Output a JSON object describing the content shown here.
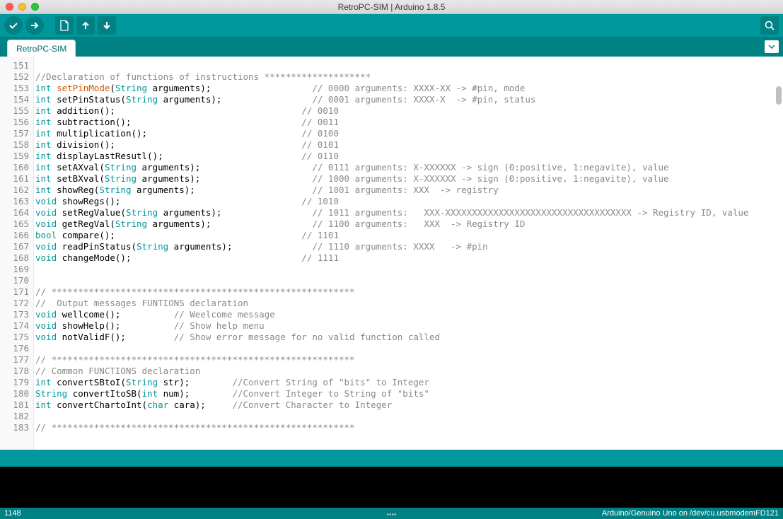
{
  "window": {
    "title": "RetroPC-SIM | Arduino 1.8.5"
  },
  "tab": {
    "name": "RetroPC-SIM"
  },
  "footer": {
    "left": "1148",
    "right": "Arduino/Genuino Uno on /dev/cu.usbmodemFD121"
  },
  "code": {
    "first_line_no": 151,
    "lines": [
      {
        "n": 151,
        "tokens": []
      },
      {
        "n": 152,
        "tokens": [
          {
            "t": "//Declaration of functions of instructions ********************",
            "c": "cm"
          }
        ]
      },
      {
        "n": 153,
        "tokens": [
          {
            "t": "int ",
            "c": "kw"
          },
          {
            "t": "setPinMode",
            "c": "fn"
          },
          {
            "t": "("
          },
          {
            "t": "String",
            "c": "kw"
          },
          {
            "t": " arguments);                   "
          },
          {
            "t": "// 0000 arguments: XXXX-XX -> #pin, mode",
            "c": "cm"
          }
        ]
      },
      {
        "n": 154,
        "tokens": [
          {
            "t": "int ",
            "c": "kw"
          },
          {
            "t": "setPinStatus("
          },
          {
            "t": "String",
            "c": "kw"
          },
          {
            "t": " arguments);                 "
          },
          {
            "t": "// 0001 arguments: XXXX-X  -> #pin, status",
            "c": "cm"
          }
        ]
      },
      {
        "n": 155,
        "tokens": [
          {
            "t": "int ",
            "c": "kw"
          },
          {
            "t": "addition();                                   "
          },
          {
            "t": "// 0010",
            "c": "cm"
          }
        ]
      },
      {
        "n": 156,
        "tokens": [
          {
            "t": "int ",
            "c": "kw"
          },
          {
            "t": "subtraction();                                "
          },
          {
            "t": "// 0011",
            "c": "cm"
          }
        ]
      },
      {
        "n": 157,
        "tokens": [
          {
            "t": "int ",
            "c": "kw"
          },
          {
            "t": "multiplication();                             "
          },
          {
            "t": "// 0100",
            "c": "cm"
          }
        ]
      },
      {
        "n": 158,
        "tokens": [
          {
            "t": "int ",
            "c": "kw"
          },
          {
            "t": "division();                                   "
          },
          {
            "t": "// 0101",
            "c": "cm"
          }
        ]
      },
      {
        "n": 159,
        "tokens": [
          {
            "t": "int ",
            "c": "kw"
          },
          {
            "t": "displayLastResutl();                          "
          },
          {
            "t": "// 0110",
            "c": "cm"
          }
        ]
      },
      {
        "n": 160,
        "tokens": [
          {
            "t": "int ",
            "c": "kw"
          },
          {
            "t": "setAXval("
          },
          {
            "t": "String",
            "c": "kw"
          },
          {
            "t": " arguments);                     "
          },
          {
            "t": "// 0111 arguments: X-XXXXXX -> sign (0:positive, 1:negavite), value",
            "c": "cm"
          }
        ]
      },
      {
        "n": 161,
        "tokens": [
          {
            "t": "int ",
            "c": "kw"
          },
          {
            "t": "setBXval("
          },
          {
            "t": "String",
            "c": "kw"
          },
          {
            "t": " arguments);                     "
          },
          {
            "t": "// 1000 arguments: X-XXXXXX -> sign (0:positive, 1:negavite), value",
            "c": "cm"
          }
        ]
      },
      {
        "n": 162,
        "tokens": [
          {
            "t": "int ",
            "c": "kw"
          },
          {
            "t": "showReg("
          },
          {
            "t": "String",
            "c": "kw"
          },
          {
            "t": " arguments);                      "
          },
          {
            "t": "// 1001 arguments: XXX  -> registry",
            "c": "cm"
          }
        ]
      },
      {
        "n": 163,
        "tokens": [
          {
            "t": "void ",
            "c": "kw"
          },
          {
            "t": "showRegs();                                  "
          },
          {
            "t": "// 1010",
            "c": "cm"
          }
        ]
      },
      {
        "n": 164,
        "tokens": [
          {
            "t": "void ",
            "c": "kw"
          },
          {
            "t": "setRegValue("
          },
          {
            "t": "String",
            "c": "kw"
          },
          {
            "t": " arguments);                 "
          },
          {
            "t": "// 1011 arguments:   XXX-XXXXXXXXXXXXXXXXXXXXXXXXXXXXXXXXXXX -> Registry ID, value",
            "c": "cm"
          }
        ]
      },
      {
        "n": 165,
        "tokens": [
          {
            "t": "void ",
            "c": "kw"
          },
          {
            "t": "getRegVal("
          },
          {
            "t": "String",
            "c": "kw"
          },
          {
            "t": " arguments);                   "
          },
          {
            "t": "// 1100 arguments:   XXX  -> Registry ID",
            "c": "cm"
          }
        ]
      },
      {
        "n": 166,
        "tokens": [
          {
            "t": "bool ",
            "c": "kw"
          },
          {
            "t": "compare();                                   "
          },
          {
            "t": "// 1101",
            "c": "cm"
          }
        ]
      },
      {
        "n": 167,
        "tokens": [
          {
            "t": "void ",
            "c": "kw"
          },
          {
            "t": "readPinStatus("
          },
          {
            "t": "String",
            "c": "kw"
          },
          {
            "t": " arguments);               "
          },
          {
            "t": "// 1110 arguments: XXXX   -> #pin",
            "c": "cm"
          }
        ]
      },
      {
        "n": 168,
        "tokens": [
          {
            "t": "void ",
            "c": "kw"
          },
          {
            "t": "changeMode();                                "
          },
          {
            "t": "// 1111",
            "c": "cm"
          }
        ]
      },
      {
        "n": 169,
        "tokens": []
      },
      {
        "n": 170,
        "tokens": []
      },
      {
        "n": 171,
        "tokens": [
          {
            "t": "// *********************************************************",
            "c": "cm"
          }
        ]
      },
      {
        "n": 172,
        "tokens": [
          {
            "t": "//  Output messages FUNTIONS declaration",
            "c": "cm"
          }
        ]
      },
      {
        "n": 173,
        "tokens": [
          {
            "t": "void ",
            "c": "kw"
          },
          {
            "t": "wellcome();          "
          },
          {
            "t": "// Weelcome message",
            "c": "cm"
          }
        ]
      },
      {
        "n": 174,
        "tokens": [
          {
            "t": "void ",
            "c": "kw"
          },
          {
            "t": "showHelp();          "
          },
          {
            "t": "// Show help menu",
            "c": "cm"
          }
        ]
      },
      {
        "n": 175,
        "tokens": [
          {
            "t": "void ",
            "c": "kw"
          },
          {
            "t": "notValidF();         "
          },
          {
            "t": "// Show error message for no valid function called",
            "c": "cm"
          }
        ]
      },
      {
        "n": 176,
        "tokens": []
      },
      {
        "n": 177,
        "tokens": [
          {
            "t": "// *********************************************************",
            "c": "cm"
          }
        ]
      },
      {
        "n": 178,
        "tokens": [
          {
            "t": "// Common FUNCTIONS declaration",
            "c": "cm"
          }
        ]
      },
      {
        "n": 179,
        "tokens": [
          {
            "t": "int ",
            "c": "kw"
          },
          {
            "t": "convertSBtoI("
          },
          {
            "t": "String",
            "c": "kw"
          },
          {
            "t": " str);        "
          },
          {
            "t": "//Convert String of \"bits\" to Integer",
            "c": "cm"
          }
        ]
      },
      {
        "n": 180,
        "tokens": [
          {
            "t": "String ",
            "c": "kw"
          },
          {
            "t": "convertItoSB("
          },
          {
            "t": "int",
            "c": "kw"
          },
          {
            "t": " num);        "
          },
          {
            "t": "//Convert Integer to String of \"bits\"",
            "c": "cm"
          }
        ]
      },
      {
        "n": 181,
        "tokens": [
          {
            "t": "int ",
            "c": "kw"
          },
          {
            "t": "convertChartoInt("
          },
          {
            "t": "char",
            "c": "kw"
          },
          {
            "t": " cara);     "
          },
          {
            "t": "//Convert Character to Integer",
            "c": "cm"
          }
        ]
      },
      {
        "n": 182,
        "tokens": []
      },
      {
        "n": 183,
        "tokens": [
          {
            "t": "// *********************************************************",
            "c": "cm"
          }
        ]
      }
    ]
  }
}
